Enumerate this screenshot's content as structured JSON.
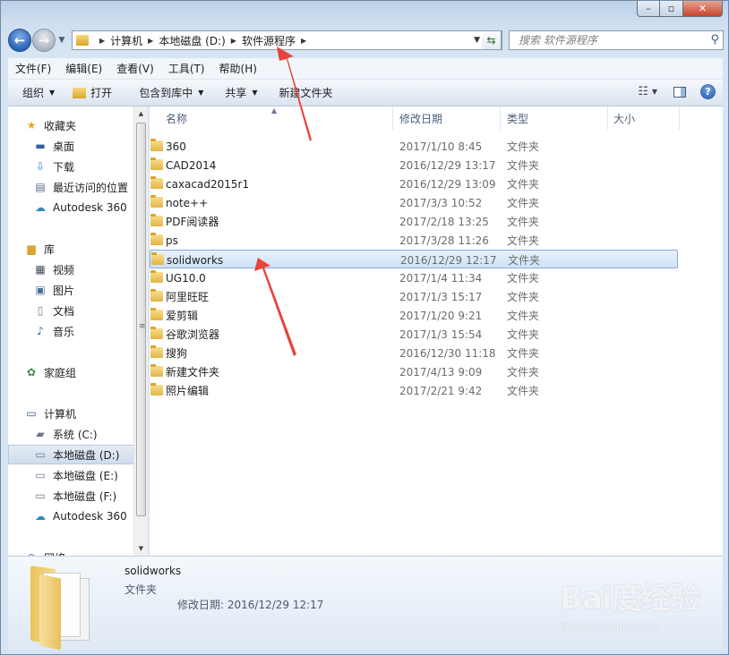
{
  "addressbar": {
    "crumbs": [
      "计算机",
      "本地磁盘 (D:)",
      "软件源程序"
    ],
    "search_placeholder": "搜索 软件源程序"
  },
  "menubar": [
    "文件(F)",
    "编辑(E)",
    "查看(V)",
    "工具(T)",
    "帮助(H)"
  ],
  "commandbar": {
    "organize": "组织",
    "open": "打开",
    "include_library": "包含到库中",
    "share": "共享",
    "new_folder": "新建文件夹"
  },
  "navpane": {
    "favorites": {
      "header": "收藏夹",
      "items": [
        "桌面",
        "下载",
        "最近访问的位置",
        "Autodesk 360"
      ]
    },
    "libraries": {
      "header": "库",
      "items": [
        "视频",
        "图片",
        "文档",
        "音乐"
      ]
    },
    "homegroup": "家庭组",
    "computer": {
      "header": "计算机",
      "items": [
        "系统 (C:)",
        "本地磁盘 (D:)",
        "本地磁盘 (E:)",
        "本地磁盘 (F:)",
        "Autodesk 360"
      ],
      "selected": "本地磁盘 (D:)"
    },
    "network": "网络"
  },
  "columns": [
    "名称",
    "修改日期",
    "类型",
    "大小"
  ],
  "files": [
    {
      "name": "360",
      "date": "2017/1/10 8:45",
      "type": "文件夹"
    },
    {
      "name": "CAD2014",
      "date": "2016/12/29 13:17",
      "type": "文件夹"
    },
    {
      "name": "caxacad2015r1",
      "date": "2016/12/29 13:09",
      "type": "文件夹"
    },
    {
      "name": "note++",
      "date": "2017/3/3 10:52",
      "type": "文件夹"
    },
    {
      "name": "PDF阅读器",
      "date": "2017/2/18 13:25",
      "type": "文件夹"
    },
    {
      "name": "ps",
      "date": "2017/3/28 11:26",
      "type": "文件夹"
    },
    {
      "name": "solidworks",
      "date": "2016/12/29 12:17",
      "type": "文件夹",
      "selected": true
    },
    {
      "name": "UG10.0",
      "date": "2017/1/4 11:34",
      "type": "文件夹"
    },
    {
      "name": "阿里旺旺",
      "date": "2017/1/3 15:17",
      "type": "文件夹"
    },
    {
      "name": "爱剪辑",
      "date": "2017/1/20 9:21",
      "type": "文件夹"
    },
    {
      "name": "谷歌浏览器",
      "date": "2017/1/3 15:54",
      "type": "文件夹"
    },
    {
      "name": "搜狗",
      "date": "2016/12/30 11:18",
      "type": "文件夹"
    },
    {
      "name": "新建文件夹",
      "date": "2017/4/13 9:09",
      "type": "文件夹"
    },
    {
      "name": "照片编辑",
      "date": "2017/2/21 9:42",
      "type": "文件夹"
    }
  ],
  "details": {
    "name": "solidworks",
    "type": "文件夹",
    "modified": "修改日期: 2016/12/29 12:17"
  },
  "watermark": {
    "logo": "Bai度经验",
    "url": "jingyan.baidu.com"
  },
  "colors": {
    "selection": "#cfe2f7",
    "annotation_arrow": "#e8433a"
  }
}
